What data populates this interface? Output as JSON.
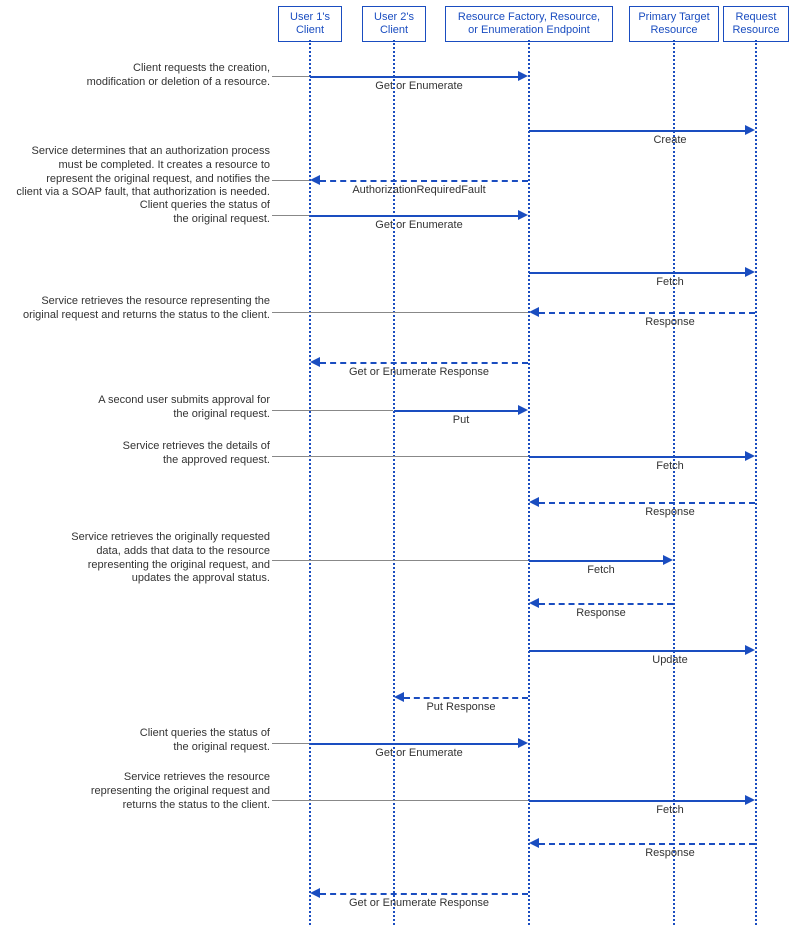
{
  "actors": {
    "user1": "User 1's\nClient",
    "user2": "User 2's\nClient",
    "endpoint": "Resource Factory, Resource,\nor Enumeration Endpoint",
    "primary": "Primary Target\nResource",
    "request": "Request\nResource"
  },
  "notes": {
    "n1": "Client requests the creation,\nmodification or deletion of a resource.",
    "n2": "Service determines that an authorization process\nmust be completed. It creates a resource to\nrepresent the original request, and notifies the\nclient via a SOAP fault, that authorization is needed.",
    "n3": "Client queries the status of\nthe original request.",
    "n4": "Service retrieves the resource representing the\noriginal request and returns the status to the client.",
    "n5": "A second user submits approval for\nthe original request.",
    "n6": "Service retrieves the details of\nthe approved  request.",
    "n7": "Service retrieves the originally requested\ndata, adds that data to the resource\nrepresenting the original request, and\nupdates the approval status.",
    "n8": "Client queries the status of\nthe original request.",
    "n9": "Service retrieves the resource\nrepresenting the original request and\nreturns the status to the client."
  },
  "messages": {
    "m1": "Get or Enumerate",
    "m2": "Create",
    "m3": "AuthorizationRequiredFault",
    "m4": "Get or Enumerate",
    "m5": "Fetch",
    "m6": "Response",
    "m7": "Get or Enumerate Response",
    "m8": "Put",
    "m9": "Fetch",
    "m10": "Response",
    "m11": "Fetch",
    "m12": "Response",
    "m13": "Update",
    "m14": "Put Response",
    "m15": "Get or Enumerate",
    "m16": "Fetch",
    "m17": "Response",
    "m18": "Get or Enumerate Response"
  }
}
